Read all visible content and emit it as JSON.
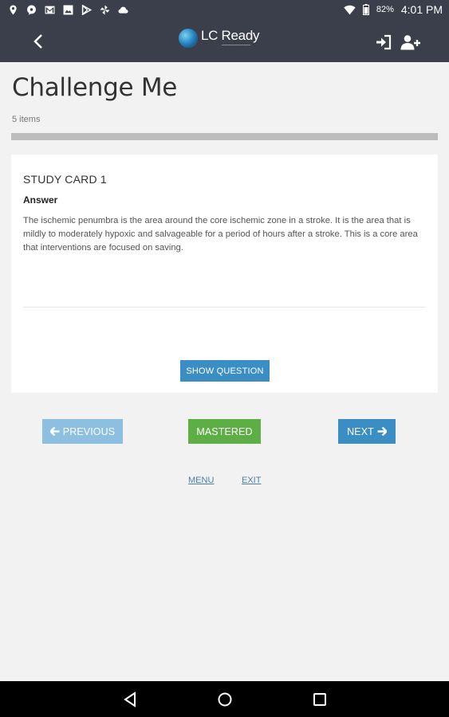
{
  "status_bar": {
    "left_icons": [
      "location-pin-icon",
      "chat-bubble-icon",
      "gmail-icon",
      "image-icon",
      "play-store-icon",
      "pinwheel-icon",
      "cloud-icon"
    ],
    "battery_percent": "82%",
    "time": "4:01 PM"
  },
  "app_bar": {
    "logo_text": "LC Ready"
  },
  "page": {
    "title": "Challenge Me",
    "item_count": "5 items",
    "progress_fraction": 1.0
  },
  "card": {
    "heading": "STUDY CARD 1",
    "subheading": "Answer",
    "body": "The ischemic penumbra is the area around the core ischemic zone in a stroke.  It is the area that is mildly to moderately hypoxic and salvageable for a period of hours after a stroke. This is a core area that interventions are focused on saving.",
    "show_question_label": "SHOW QUESTION"
  },
  "nav_buttons": {
    "previous_label": "PREVIOUS",
    "mastered_label": "MASTERED",
    "next_label": "NEXT"
  },
  "links": {
    "menu_label": "MENU",
    "exit_label": "EXIT"
  },
  "colors": {
    "app_bar": "#3b3f4b",
    "primary_button": "#3b8ec4",
    "disabled_button": "#8dbfe0",
    "mastered_button": "#5cae45",
    "link": "#4a7fa8"
  }
}
